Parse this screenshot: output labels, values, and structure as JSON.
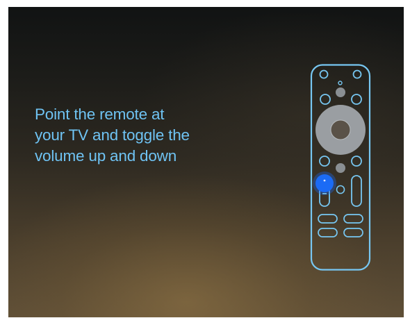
{
  "screen": {
    "instruction_lines": [
      "Point the remote at",
      "your TV and toggle the",
      "volume up and down"
    ]
  },
  "remote_illustration": {
    "icon": "tv-remote-icon",
    "highlighted_button": "volume-down",
    "outline_color": "#77c7f2",
    "highlight_color": "#1b6bf5",
    "button_fill_color": "#8a8f93",
    "dpad_fill_color": "#9a9ea2"
  }
}
